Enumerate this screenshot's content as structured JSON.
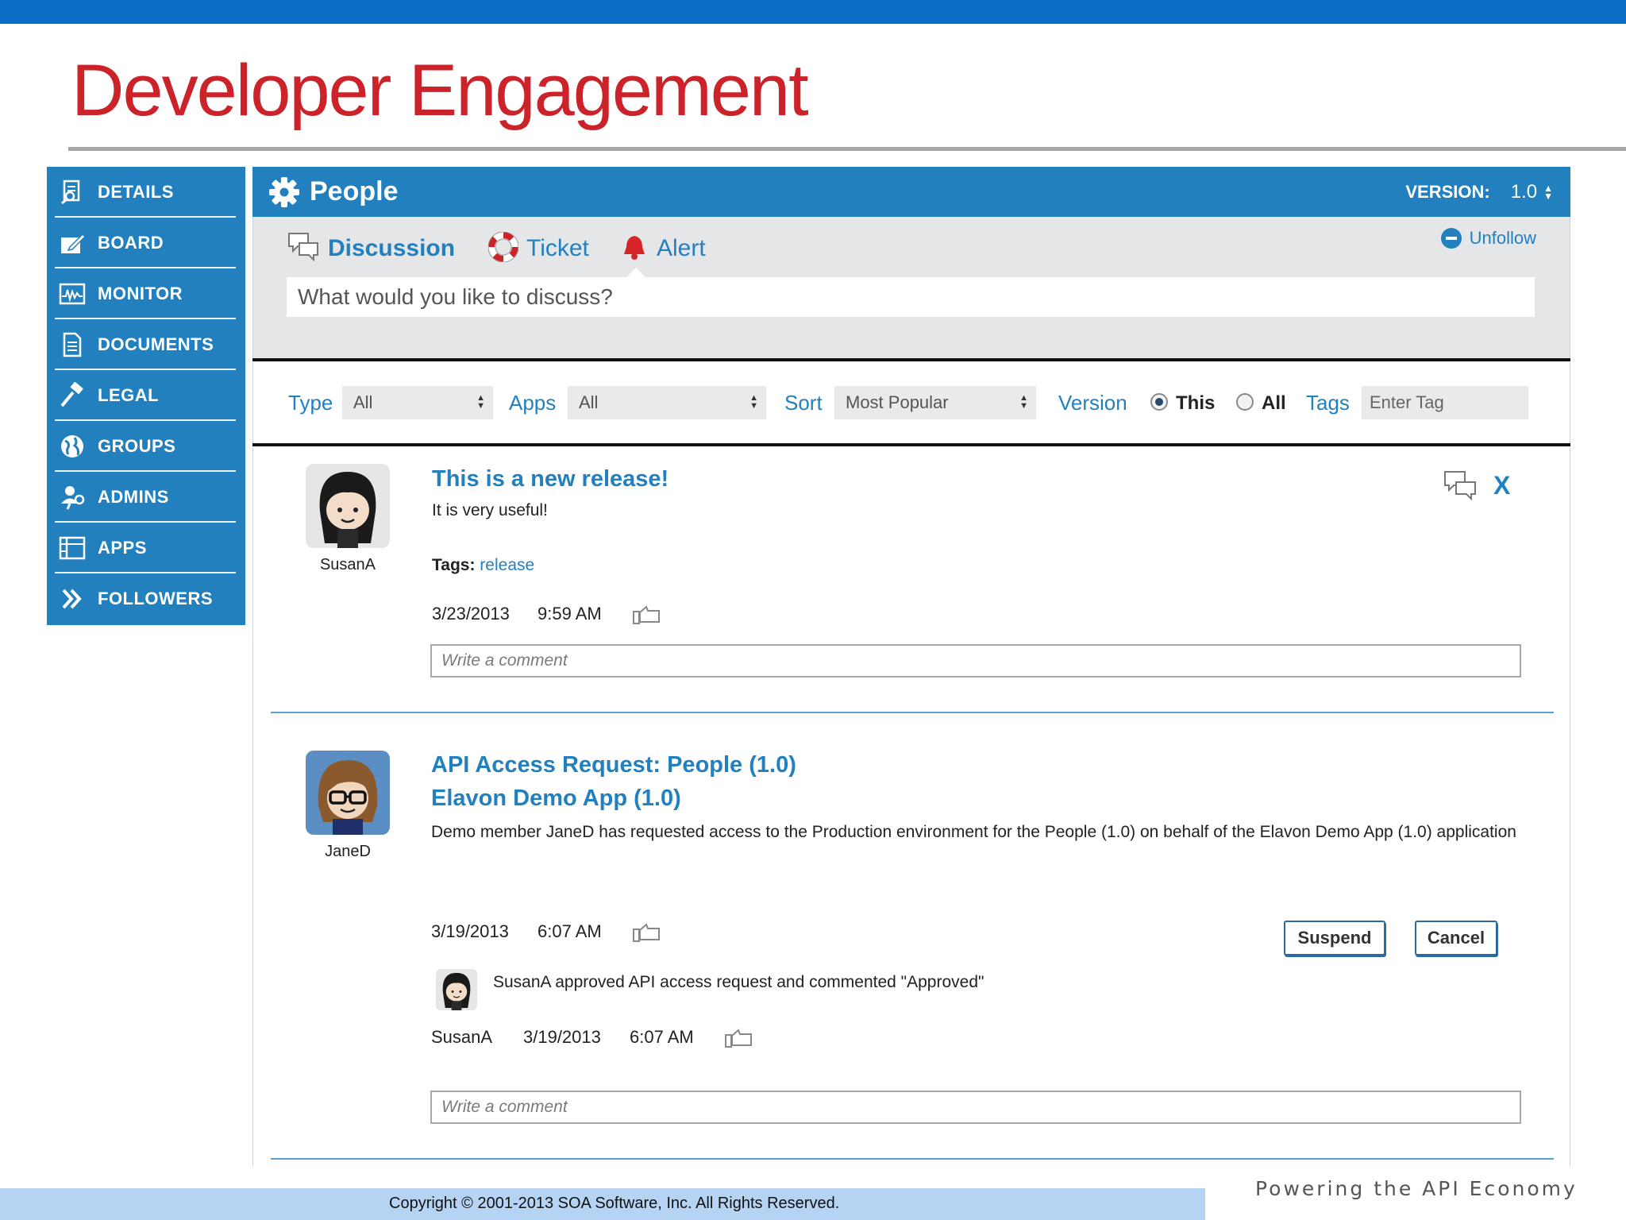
{
  "slide": {
    "title": "Developer Engagement",
    "copyright": "Copyright © 2001-2013 SOA Software, Inc. All Rights Reserved.",
    "tagline": "Powering the API Economy"
  },
  "sidebar": {
    "items": [
      {
        "label": "DETAILS",
        "icon": "details-icon"
      },
      {
        "label": "BOARD",
        "icon": "board-icon"
      },
      {
        "label": "MONITOR",
        "icon": "monitor-icon"
      },
      {
        "label": "DOCUMENTS",
        "icon": "documents-icon"
      },
      {
        "label": "LEGAL",
        "icon": "legal-gavel-icon"
      },
      {
        "label": "GROUPS",
        "icon": "groups-globe-icon"
      },
      {
        "label": "ADMINS",
        "icon": "admins-icon"
      },
      {
        "label": "APPS",
        "icon": "apps-icon"
      },
      {
        "label": "FOLLOWERS",
        "icon": "followers-chevron-icon"
      }
    ]
  },
  "panel": {
    "title": "People",
    "version_label": "VERSION:",
    "version_value": "1.0"
  },
  "compose": {
    "tabs": [
      {
        "label": "Discussion",
        "icon": "discussion-icon",
        "active": true
      },
      {
        "label": "Ticket",
        "icon": "lifebuoy-icon",
        "active": false
      },
      {
        "label": "Alert",
        "icon": "bell-icon",
        "active": false
      }
    ],
    "unfollow_label": "Unfollow",
    "placeholder": "What would you like to discuss?"
  },
  "filters": {
    "type_label": "Type",
    "type_value": "All",
    "apps_label": "Apps",
    "apps_value": "All",
    "sort_label": "Sort",
    "sort_value": "Most Popular",
    "version_label": "Version",
    "version_this": "This",
    "version_all": "All",
    "version_selected": "This",
    "tags_label": "Tags",
    "tags_placeholder": "Enter Tag"
  },
  "posts": [
    {
      "author": "SusanA",
      "title": "This is a new release!",
      "body": "It is very useful!",
      "tags_label": "Tags:",
      "tag": "release",
      "date": "3/23/2013",
      "time": "9:59 AM",
      "comment_placeholder": "Write a comment",
      "close_label": "X"
    },
    {
      "author": "JaneD",
      "title_line1": "API Access Request: People (1.0)",
      "title_line2": "Elavon Demo App (1.0)",
      "body": "Demo member JaneD has requested access to the Production environment for the People (1.0) on behalf of the Elavon Demo App (1.0) application",
      "date": "3/19/2013",
      "time": "6:07 AM",
      "suspend_label": "Suspend",
      "cancel_label": "Cancel",
      "reply": {
        "author": "SusanA",
        "text": "SusanA approved API access request and commented \"Approved\"",
        "date": "3/19/2013",
        "time": "6:07 AM"
      },
      "comment_placeholder": "Write a comment"
    }
  ],
  "colors": {
    "brand_blue": "#2380bf",
    "title_red": "#cc2229",
    "top_bar": "#0b6cc4",
    "footer_bar": "#b5d3f3"
  }
}
